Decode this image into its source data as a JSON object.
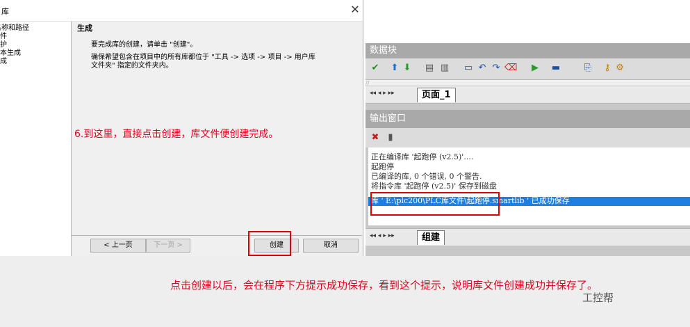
{
  "dialog": {
    "title": "库",
    "close": "✕",
    "nav_items": [
      "名称和路径",
      "组件",
      "保护",
      "版本生成",
      "生成"
    ],
    "heading": "生成",
    "paragraph1": "要完成库的创建，请单击 \"创建\"。",
    "paragraph2": "确保希望包含在项目中的所有库都位于 \"工具 -> 选项 -> 项目 -> 用户库文件夹\" 指定的文件夹内。",
    "buttons": {
      "prev": "< 上一页",
      "next": "下一页 >",
      "create": "创建",
      "cancel": "取消"
    }
  },
  "annotation_step": "6.到这里，直接点击创建，库文件便创建完成。",
  "ide": {
    "data_block_title": "数据块",
    "editor_snippet": "//",
    "tab_nav": "◂◂ ◂ ▸ ▸▸",
    "page_tab": "页面_1",
    "output_title": "输出窗口",
    "output_lines": [
      "正在编译库 '起跑停 (v2.5)'....",
      "起跑停",
      "已编译的库, 0 个错误, 0 个警告.",
      "将指令库 '起跑停 (v2.5)' 保存到磁盘",
      "库 ' E:\\plc200\\PLC库文件\\起跑停.smartlib ' 已成功保存"
    ],
    "build_tab": "组建",
    "toolbar_icons": [
      "check-icon",
      "up-arrow-icon",
      "down-arrow-icon",
      "insert-row-icon",
      "delete-row-icon",
      "box-icon",
      "undo-icon",
      "redo-icon",
      "clear-icon",
      "run-icon",
      "comment-icon",
      "insert-icon",
      "key-icon",
      "tool-icon"
    ],
    "output_toolbar_icons": [
      "clear-output-icon",
      "save-output-icon"
    ]
  },
  "caption": "点击创建以后，会在程序下方提示成功保存，看到这个提示，说明库文件创建成功并保存了。",
  "watermark": "工控帮",
  "colors": {
    "annotation": "#e6001e",
    "highlight": "#1e7fe0",
    "box": "#e00000"
  }
}
